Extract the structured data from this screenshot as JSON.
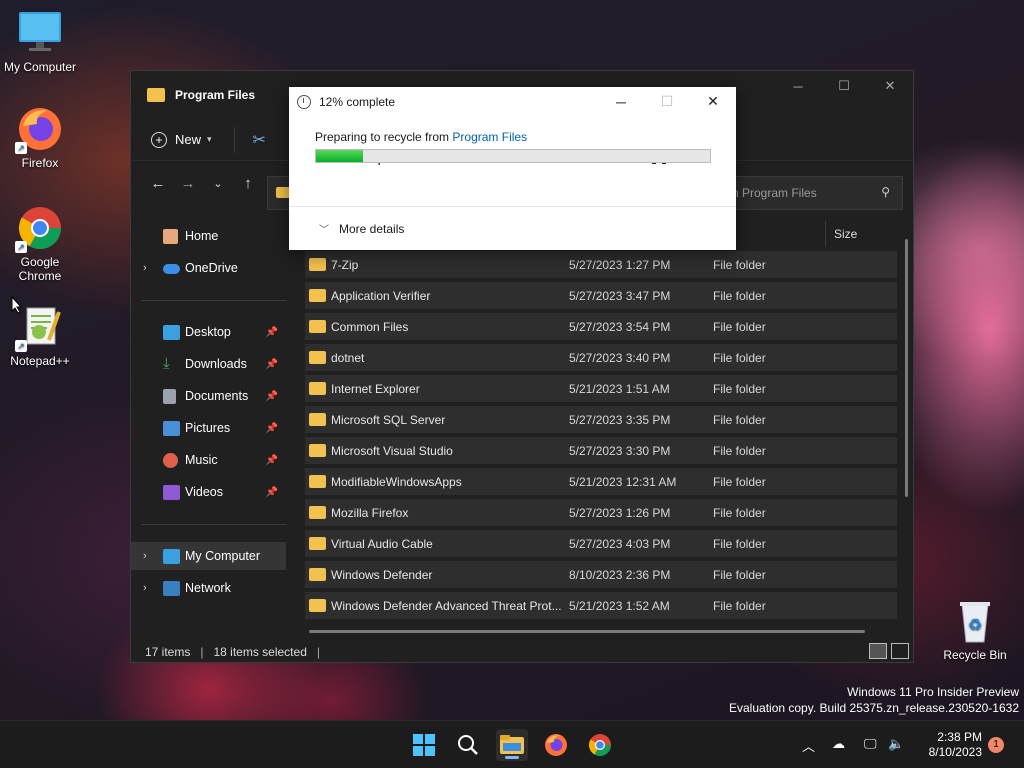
{
  "desktop": {
    "icons": [
      {
        "label": "My Computer",
        "icon": "monitor-icon"
      },
      {
        "label": "Firefox",
        "icon": "firefox-icon"
      },
      {
        "label": "Google\nChrome",
        "icon": "chrome-icon"
      },
      {
        "label": "Notepad++",
        "icon": "notepadpp-icon"
      },
      {
        "label": "Recycle Bin",
        "icon": "recycle-bin-icon"
      }
    ],
    "watermark_line1": "Windows 11 Pro Insider Preview",
    "watermark_line2": "Evaluation copy. Build 25375.zn_release.230520-1632"
  },
  "explorer": {
    "title": "Program Files",
    "new_label": "New",
    "search_placeholder": "Search Program Files",
    "search_visible": "h Program Files",
    "column_size": "Size",
    "sidebar": {
      "home": "Home",
      "onedrive": "OneDrive",
      "desktop": "Desktop",
      "downloads": "Downloads",
      "documents": "Documents",
      "pictures": "Pictures",
      "music": "Music",
      "videos": "Videos",
      "my_computer": "My Computer",
      "network": "Network"
    },
    "files": [
      {
        "name": "7-Zip",
        "date": "5/27/2023 1:27 PM",
        "type": "File folder"
      },
      {
        "name": "Application Verifier",
        "date": "5/27/2023 3:47 PM",
        "type": "File folder"
      },
      {
        "name": "Common Files",
        "date": "5/27/2023 3:54 PM",
        "type": "File folder"
      },
      {
        "name": "dotnet",
        "date": "5/27/2023 3:40 PM",
        "type": "File folder"
      },
      {
        "name": "Internet Explorer",
        "date": "5/21/2023 1:51 AM",
        "type": "File folder"
      },
      {
        "name": "Microsoft SQL Server",
        "date": "5/27/2023 3:35 PM",
        "type": "File folder"
      },
      {
        "name": "Microsoft Visual Studio",
        "date": "5/27/2023 3:30 PM",
        "type": "File folder"
      },
      {
        "name": "ModifiableWindowsApps",
        "date": "5/21/2023 12:31 AM",
        "type": "File folder"
      },
      {
        "name": "Mozilla Firefox",
        "date": "5/27/2023 1:26 PM",
        "type": "File folder"
      },
      {
        "name": "Virtual Audio Cable",
        "date": "5/27/2023 4:03 PM",
        "type": "File folder"
      },
      {
        "name": "Windows Defender",
        "date": "8/10/2023 2:36 PM",
        "type": "File folder"
      },
      {
        "name": "Windows Defender Advanced Threat Prot...",
        "date": "5/21/2023 1:52 AM",
        "type": "File folder"
      }
    ],
    "status_items": "17 items",
    "status_selected": "18 items selected"
  },
  "dialog": {
    "title": "12% complete",
    "prep_text": "Preparing to recycle from",
    "prep_link": "Program Files",
    "percent_text": "12% complete",
    "progress": 0.12,
    "more_details": "More details"
  },
  "taskbar": {
    "time": "2:38 PM",
    "date": "8/10/2023",
    "notifications": "1"
  }
}
